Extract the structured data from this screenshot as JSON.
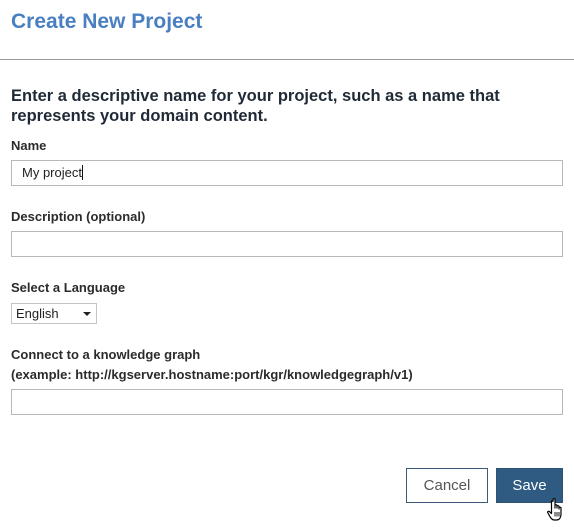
{
  "dialog": {
    "title": "Create New Project",
    "intro": "Enter a descriptive name for your project, such as a name that represents your domain content."
  },
  "fields": {
    "name": {
      "label": "Name",
      "value": "My project"
    },
    "description": {
      "label": "Description (optional)",
      "value": ""
    },
    "language": {
      "label": "Select a Language",
      "selected": "English"
    },
    "knowledge_graph": {
      "label_line1": "Connect to a knowledge graph",
      "label_line2": "(example: http://kgserver.hostname:port/kgr/knowledgegraph/v1)",
      "value": ""
    }
  },
  "buttons": {
    "cancel": "Cancel",
    "save": "Save"
  },
  "icons": {
    "cursor": "hand-pointer-icon",
    "dropdown": "caret-down-icon"
  },
  "colors": {
    "title": "#4a7fc1",
    "primary": "#2f5a82"
  }
}
